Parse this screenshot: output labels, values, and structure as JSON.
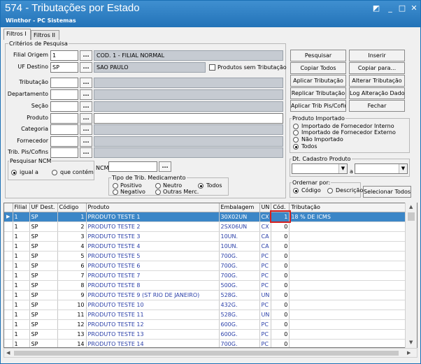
{
  "window": {
    "title": "574 - Tributações por Estado",
    "subtitle": "Winthor - PC Sistemas"
  },
  "tabs": [
    "Filtros I",
    "Filtros II"
  ],
  "criteria": {
    "group_label": "Critérios de Pesquisa",
    "filial_origem": {
      "label": "Filial Origem",
      "value": "1",
      "desc": "COD. 1 - FILIAL NORMAL"
    },
    "uf_destino": {
      "label": "UF Destino",
      "value": "SP",
      "desc": "SAO PAULO"
    },
    "produtos_sem_tributacao": "Produtos sem Tributação",
    "tributacao": "Tributação",
    "departamento": "Departamento",
    "secao": "Seção",
    "produto": "Produto",
    "categoria": "Categoria",
    "fornecedor": "Fornecedor",
    "trib_pis_cofins": "Trib. Pis/Cofins",
    "browse_label": "...",
    "pesquisar_ncm": {
      "label": "Pesquisar NCM",
      "igual": "igual a",
      "contem": "que contém"
    },
    "ncm_label": "NCM",
    "tipo_trib_medicamento": {
      "label": "Tipo de Trib. Medicamento",
      "positivo": "Positivo",
      "negativo": "Negativo",
      "neutro": "Neutro",
      "outras": "Outras Merc.",
      "todos": "Todos"
    }
  },
  "buttons": {
    "pesquisar": "Pesquisar",
    "inserir": "Inserir",
    "copiar_todos": "Copiar Todos",
    "copiar_para": "Copiar para...",
    "aplicar_tributacao": "Aplicar Tributação",
    "alterar_tributacao": "Alterar Tributação",
    "replicar_tributacao": "Replicar Tributação",
    "log_alteracao": "Log Alteração Dados",
    "aplicar_trib_pis": "Aplicar Trib Pis/Cofins",
    "fechar": "Fechar",
    "selecionar_todos": "Selecionar Todos"
  },
  "produto_importado": {
    "label": "Produto Importado",
    "options": [
      "Importado de Fornecedor Interno",
      "Importado de Fornecedor Externo",
      "Não Importado",
      "Todos"
    ]
  },
  "dt_cadastro": {
    "label": "Dt. Cadastro Produto",
    "separator": "a"
  },
  "ordenar": {
    "label": "Ordernar por:",
    "codigo": "Código",
    "descricao": "Descrição"
  },
  "table": {
    "columns": [
      "Filial",
      "UF Dest.",
      "Código",
      "Produto",
      "Embalagem",
      "UN",
      "Cód.",
      "Tributação"
    ],
    "rows": [
      [
        "1",
        "SP",
        "1",
        "PRODUTO TESTE 1",
        "30X02UN",
        "CX",
        "1",
        "18 % DE ICMS"
      ],
      [
        "1",
        "SP",
        "2",
        "PRODUTO TESTE 2",
        "2SX06UN",
        "CX",
        "0",
        ""
      ],
      [
        "1",
        "SP",
        "3",
        "PRODUTO TESTE 3",
        "10UN.",
        "CA",
        "0",
        ""
      ],
      [
        "1",
        "SP",
        "4",
        "PRODUTO TESTE 4",
        "10UN.",
        "CA",
        "0",
        ""
      ],
      [
        "1",
        "SP",
        "5",
        "PRODUTO TESTE 5",
        "700G.",
        "PC",
        "0",
        ""
      ],
      [
        "1",
        "SP",
        "6",
        "PRODUTO TESTE 6",
        "700G.",
        "PC",
        "0",
        ""
      ],
      [
        "1",
        "SP",
        "7",
        "PRODUTO TESTE 7",
        "700G.",
        "PC",
        "0",
        ""
      ],
      [
        "1",
        "SP",
        "8",
        "PRODUTO TESTE 8",
        "500G.",
        "PC",
        "0",
        ""
      ],
      [
        "1",
        "SP",
        "9",
        "PRODUTO TESTE 9 (ST RIO DE JANEIRO)",
        "528G.",
        "UN",
        "0",
        ""
      ],
      [
        "1",
        "SP",
        "10",
        "PRODUTO TESTE 10",
        "432G.",
        "PC",
        "0",
        ""
      ],
      [
        "1",
        "SP",
        "11",
        "PRODUTO TESTE 11",
        "528G.",
        "UN",
        "0",
        ""
      ],
      [
        "1",
        "SP",
        "12",
        "PRODUTO TESTE 12",
        "600G.",
        "PC",
        "0",
        ""
      ],
      [
        "1",
        "SP",
        "13",
        "PRODUTO TESTE 13",
        "600G.",
        "PC",
        "0",
        ""
      ],
      [
        "1",
        "SP",
        "14",
        "PRODUTO TESTE 14",
        "700G.",
        "PC",
        "0",
        ""
      ]
    ],
    "selected_row": 0
  }
}
